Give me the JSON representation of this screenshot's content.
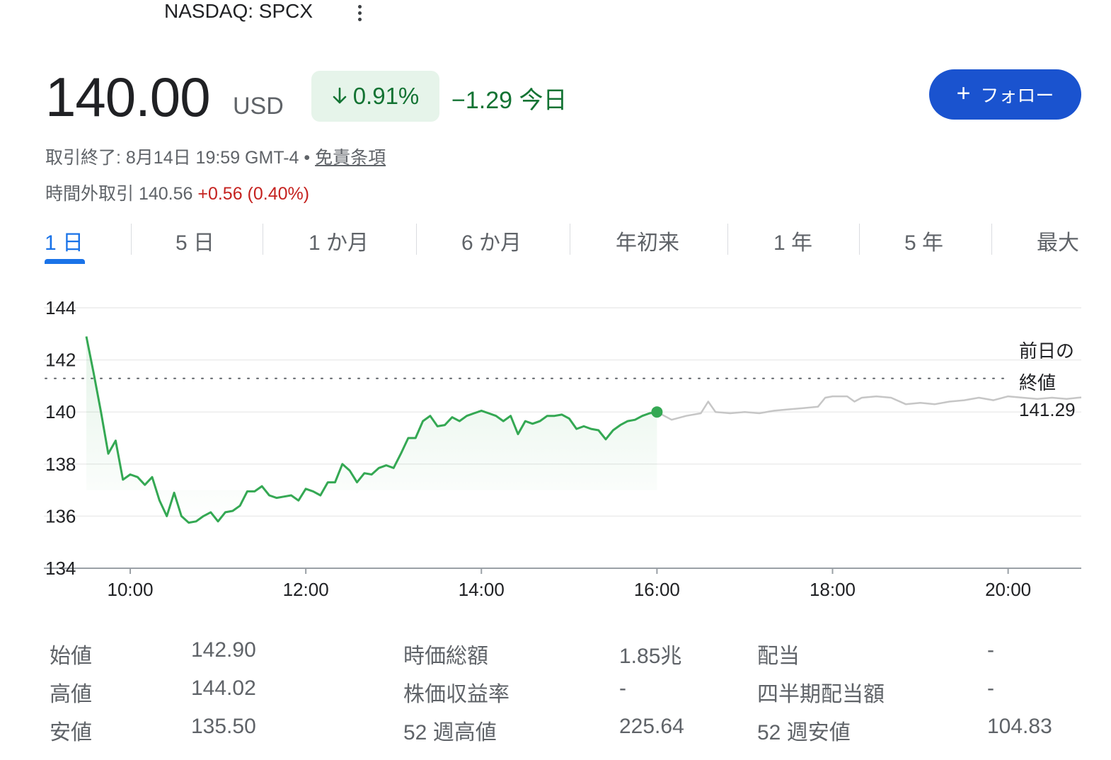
{
  "header": {
    "ticker": "NASDAQ: SPCX"
  },
  "quote": {
    "price": "140.00",
    "currency": "USD",
    "change_pct": "0.91%",
    "change_abs": "−1.29 今日",
    "follow_label": "フォロー",
    "closed_text": "取引終了: 8月14日 19:59 GMT-4 • ",
    "disclaimer": "免責条項",
    "after_hours_label": "時間外取引 140.56 ",
    "after_hours_change": "+0.56 (0.40%)"
  },
  "tabs": [
    {
      "label": "1 日",
      "active": true
    },
    {
      "label": "5 日"
    },
    {
      "label": "1 か月"
    },
    {
      "label": "6 か月"
    },
    {
      "label": "年初来"
    },
    {
      "label": "1 年"
    },
    {
      "label": "5 年"
    },
    {
      "label": "最大"
    }
  ],
  "chart_data": {
    "type": "line",
    "ylim": [
      134,
      144
    ],
    "yticks": [
      "134",
      "136",
      "138",
      "140",
      "142",
      "144"
    ],
    "xticks": [
      "10:00",
      "12:00",
      "14:00",
      "16:00",
      "18:00",
      "20:00"
    ],
    "x_range": [
      "09:30",
      "20:50"
    ],
    "grid": true,
    "previous_close": 141.29,
    "previous_close_label": [
      "前日の",
      "終値",
      "141.29"
    ],
    "colors": {
      "regular": "#34a853",
      "after_hours": "#c6c6c6",
      "marker": "#34a853"
    },
    "series": [
      {
        "session": "regular",
        "x": [
          "09:30",
          "09:35",
          "09:40",
          "09:45",
          "09:50",
          "09:55",
          "10:00",
          "10:05",
          "10:10",
          "10:15",
          "10:20",
          "10:25",
          "10:30",
          "10:35",
          "10:40",
          "10:45",
          "10:50",
          "10:55",
          "11:00",
          "11:05",
          "11:10",
          "11:15",
          "11:20",
          "11:25",
          "11:30",
          "11:35",
          "11:40",
          "11:45",
          "11:50",
          "11:55",
          "12:00",
          "12:05",
          "12:10",
          "12:15",
          "12:20",
          "12:25",
          "12:30",
          "12:35",
          "12:40",
          "12:45",
          "12:50",
          "12:55",
          "13:00",
          "13:05",
          "13:10",
          "13:15",
          "13:20",
          "13:25",
          "13:30",
          "13:35",
          "13:40",
          "13:45",
          "13:50",
          "13:55",
          "14:00",
          "14:05",
          "14:10",
          "14:15",
          "14:20",
          "14:25",
          "14:30",
          "14:35",
          "14:40",
          "14:45",
          "14:50",
          "14:55",
          "15:00",
          "15:05",
          "15:10",
          "15:15",
          "15:20",
          "15:25",
          "15:30",
          "15:35",
          "15:40",
          "15:45",
          "15:50",
          "15:55",
          "16:00"
        ],
        "values": [
          142.9,
          141.5,
          140.0,
          138.4,
          138.9,
          137.4,
          137.6,
          137.5,
          137.2,
          137.5,
          136.6,
          136.0,
          136.9,
          136.0,
          135.75,
          135.8,
          136.0,
          136.15,
          135.8,
          136.15,
          136.2,
          136.4,
          136.95,
          136.95,
          137.15,
          136.8,
          136.7,
          136.75,
          136.8,
          136.6,
          137.05,
          136.95,
          136.8,
          137.3,
          137.3,
          138.0,
          137.75,
          137.3,
          137.65,
          137.6,
          137.85,
          137.95,
          137.85,
          138.4,
          139.0,
          139.0,
          139.65,
          139.85,
          139.45,
          139.5,
          139.8,
          139.65,
          139.85,
          139.95,
          140.05,
          139.95,
          139.85,
          139.65,
          139.85,
          139.15,
          139.65,
          139.55,
          139.65,
          139.85,
          139.85,
          139.9,
          139.75,
          139.35,
          139.45,
          139.35,
          139.3,
          138.95,
          139.3,
          139.5,
          139.65,
          139.7,
          139.85,
          139.95,
          140.0
        ]
      },
      {
        "session": "after_hours",
        "x": [
          "16:00",
          "16:10",
          "16:20",
          "16:30",
          "16:35",
          "16:40",
          "16:50",
          "17:00",
          "17:10",
          "17:20",
          "17:30",
          "17:40",
          "17:50",
          "17:55",
          "18:00",
          "18:10",
          "18:15",
          "18:20",
          "18:30",
          "18:40",
          "18:50",
          "19:00",
          "19:10",
          "19:20",
          "19:30",
          "19:40",
          "19:50",
          "20:00",
          "20:10",
          "20:20",
          "20:30",
          "20:40",
          "20:50"
        ],
        "values": [
          140.0,
          139.7,
          139.85,
          139.95,
          140.4,
          140.0,
          139.95,
          140.0,
          139.95,
          140.05,
          140.1,
          140.15,
          140.2,
          140.55,
          140.6,
          140.6,
          140.4,
          140.55,
          140.6,
          140.55,
          140.3,
          140.35,
          140.3,
          140.4,
          140.45,
          140.55,
          140.45,
          140.6,
          140.55,
          140.5,
          140.55,
          140.5,
          140.56
        ]
      }
    ]
  },
  "stats": [
    {
      "label": "始値",
      "value": "142.90"
    },
    {
      "label": "高値",
      "value": "144.02"
    },
    {
      "label": "安値",
      "value": "135.50"
    },
    {
      "label": "時価総額",
      "value": "1.85兆"
    },
    {
      "label": "株価収益率",
      "value": "-"
    },
    {
      "label": "52 週高値",
      "value": "225.64"
    },
    {
      "label": "配当",
      "value": "-"
    },
    {
      "label": "四半期配当額",
      "value": "-"
    },
    {
      "label": "52 週安値",
      "value": "104.83"
    }
  ],
  "icons": {
    "more": "more-vert-icon",
    "follow": "plus-icon",
    "down": "arrow-down-icon"
  }
}
